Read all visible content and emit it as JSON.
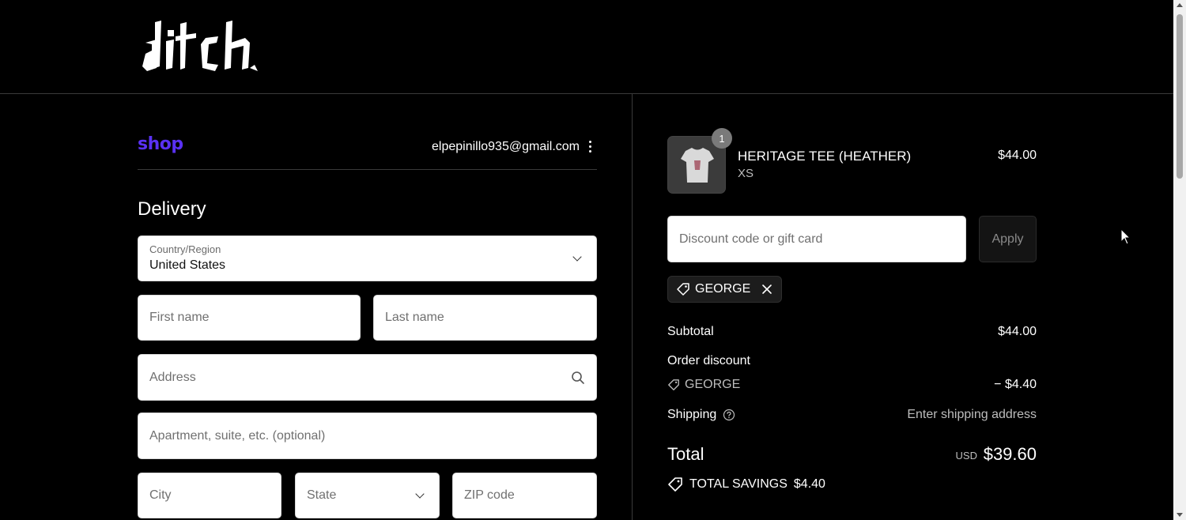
{
  "brand": {
    "logo_text": "ditch"
  },
  "shop_pay": {
    "label": "shop",
    "color": "#5a31f4"
  },
  "account": {
    "email": "elpepinillo935@gmail.com",
    "menu_icon": "kebab-menu-icon"
  },
  "delivery": {
    "title": "Delivery",
    "country": {
      "label": "Country/Region",
      "value": "United States"
    },
    "first_name": {
      "placeholder": "First name"
    },
    "last_name": {
      "placeholder": "Last name"
    },
    "address": {
      "placeholder": "Address"
    },
    "apartment": {
      "placeholder": "Apartment, suite, etc. (optional)"
    },
    "city": {
      "placeholder": "City"
    },
    "state": {
      "placeholder": "State"
    },
    "zip": {
      "placeholder": "ZIP code"
    }
  },
  "cart": {
    "item": {
      "name": "HERITAGE TEE (HEATHER)",
      "variant": "XS",
      "price": "$44.00",
      "quantity": "1"
    }
  },
  "discount": {
    "placeholder": "Discount code or gift card",
    "apply_label": "Apply",
    "applied_code": "GEORGE"
  },
  "summary": {
    "subtotal_label": "Subtotal",
    "subtotal_value": "$44.00",
    "order_discount_label": "Order discount",
    "discount_code": "GEORGE",
    "discount_value": "− $4.40",
    "shipping_label": "Shipping",
    "shipping_value": "Enter shipping address",
    "total_label": "Total",
    "currency": "USD",
    "total_value": "$39.60",
    "savings_label": "TOTAL SAVINGS",
    "savings_value": "$4.40"
  },
  "colors": {
    "background": "#000000",
    "accent": "#5a31f4",
    "divider": "#3a3a3a"
  }
}
